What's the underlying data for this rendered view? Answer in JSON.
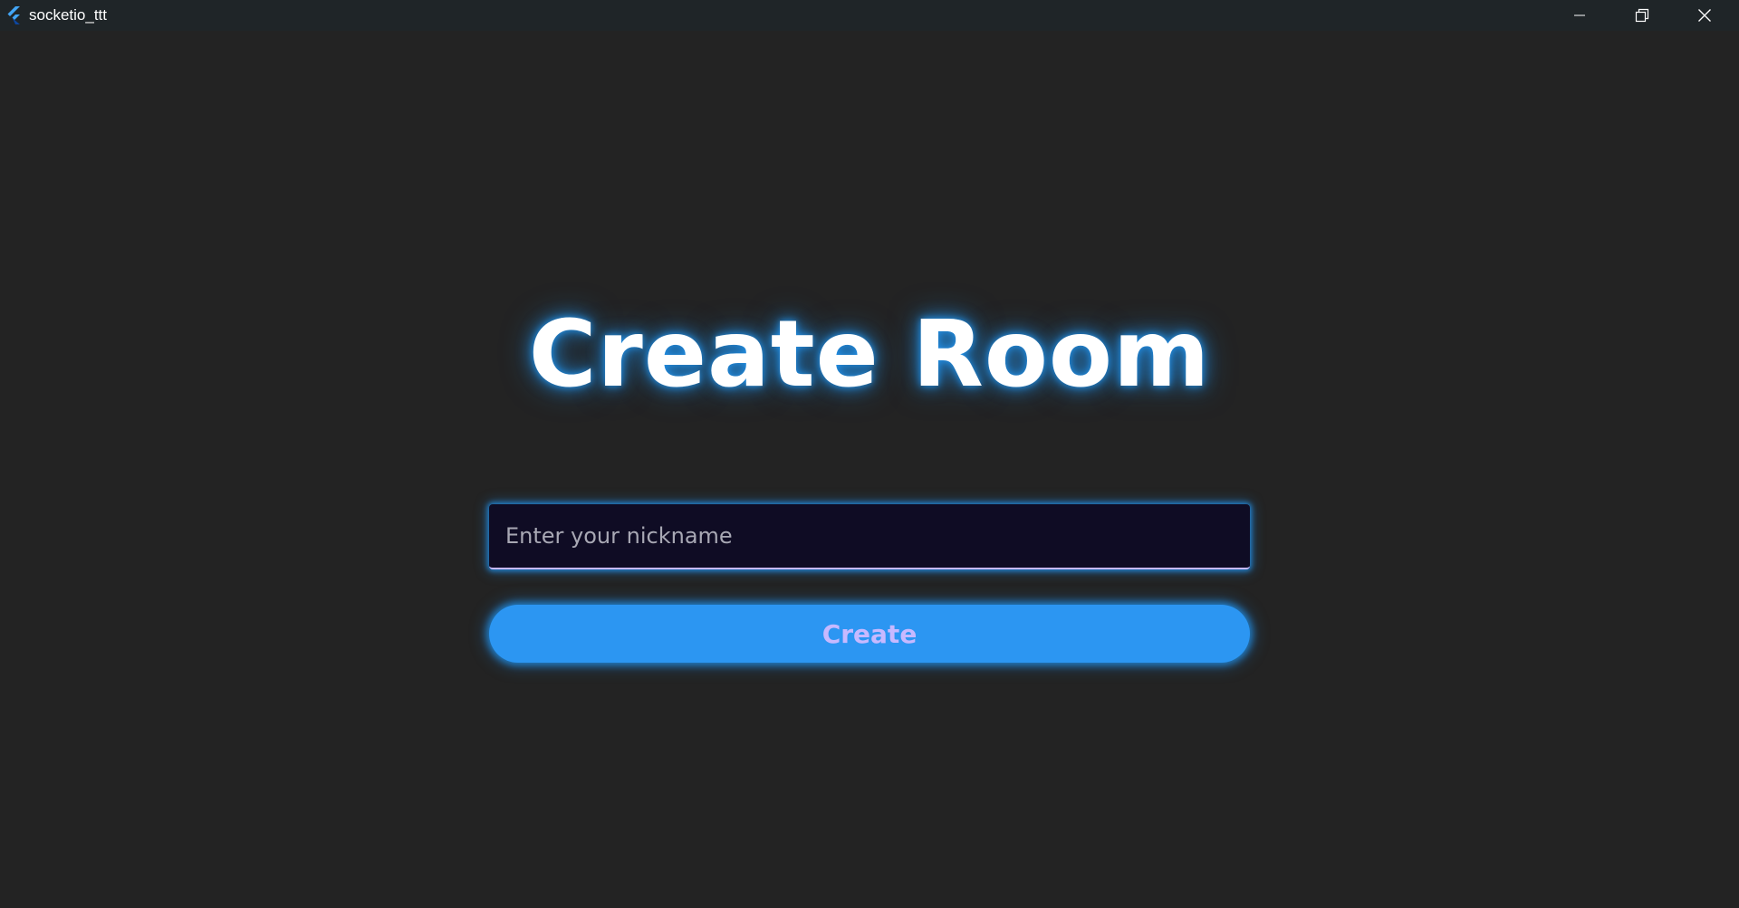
{
  "window": {
    "title": "socketio_ttt",
    "icon": "flutter-logo-icon",
    "controls": {
      "minimize_icon": "minimize-icon",
      "maximize_icon": "restore-icon",
      "close_icon": "close-icon"
    }
  },
  "main": {
    "heading": "Create Room",
    "nickname_placeholder": "Enter your nickname",
    "nickname_value": "",
    "create_label": "Create"
  },
  "colors": {
    "background": "#232323",
    "titlebar": "#1f2528",
    "accent": "#2196f3",
    "button": "#2c96f2",
    "button_text": "#c7b9ff",
    "input_background": "#0f0c24",
    "input_underline": "#c7b9ff"
  }
}
